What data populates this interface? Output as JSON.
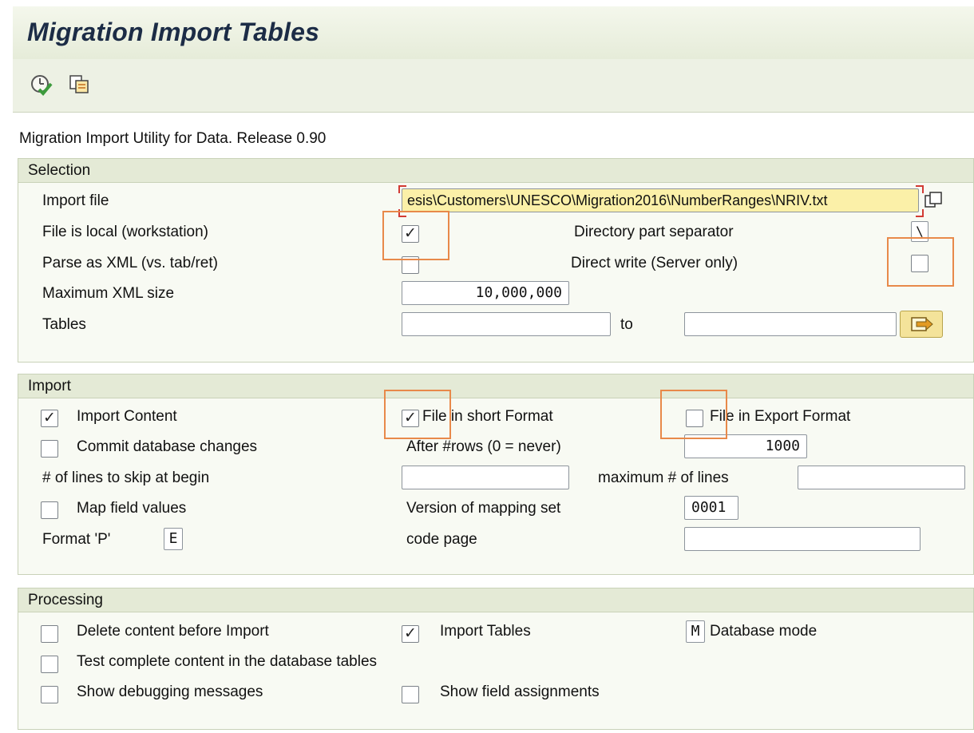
{
  "window": {
    "title": "Migration Import Tables"
  },
  "toolbar": {
    "items": [
      {
        "icon": "execute-clock-check-icon",
        "label": ""
      },
      {
        "icon": "copy-variant-icon",
        "label": ""
      }
    ]
  },
  "subtitle": "Migration Import Utility for Data.  Release 0.90",
  "selection": {
    "title": "Selection",
    "import_file_label": "Import file",
    "import_file_value": "esis\\Customers\\UNESCO\\Migration2016\\NumberRanges\\NRIV.txt",
    "file_local_label": "File is local (workstation)",
    "file_local_checked": true,
    "dir_sep_label": "Directory part separator",
    "dir_sep_value": "\\",
    "parse_xml_label": "Parse as XML (vs. tab/ret)",
    "parse_xml_checked": false,
    "direct_write_label": "Direct write (Server only)",
    "direct_write_checked": false,
    "max_xml_label": "Maximum XML size",
    "max_xml_value": "10,000,000",
    "tables_label": "Tables",
    "tables_from": "",
    "to_label": "to",
    "tables_to": ""
  },
  "import": {
    "title": "Import",
    "import_content_label": "Import Content",
    "import_content_checked": true,
    "short_format_label": "File in short Format",
    "short_format_checked": true,
    "export_format_label": "File in Export Format",
    "export_format_checked": false,
    "commit_label": "Commit database changes",
    "commit_checked": false,
    "after_rows_label": "After #rows (0 = never)",
    "after_rows_value": "1000",
    "skip_lines_label": "# of lines to skip at begin",
    "skip_lines_value": "",
    "max_lines_label": "maximum # of lines",
    "max_lines_value": "",
    "map_values_label": "Map field values",
    "map_values_checked": false,
    "mapping_set_label": "Version of mapping set",
    "mapping_set_value": "0001",
    "format_p_label": "Format 'P'",
    "format_p_value": "E",
    "code_page_label": "code page",
    "code_page_value": ""
  },
  "processing": {
    "title": "Processing",
    "delete_label": "Delete content before Import",
    "delete_checked": false,
    "import_tables_label": "Import Tables",
    "import_tables_checked": true,
    "db_mode_value": "M",
    "db_mode_label": "Database mode",
    "test_label": "Test complete content in the database tables",
    "test_checked": false,
    "debug_label": "Show debugging messages",
    "debug_checked": false,
    "assignments_label": "Show field assignments",
    "assignments_checked": false
  },
  "colors": {
    "highlight": "#e8894a",
    "group_header": "#e4ead6",
    "title": "#1c2c46",
    "input_focus": "#fbf0a8"
  }
}
